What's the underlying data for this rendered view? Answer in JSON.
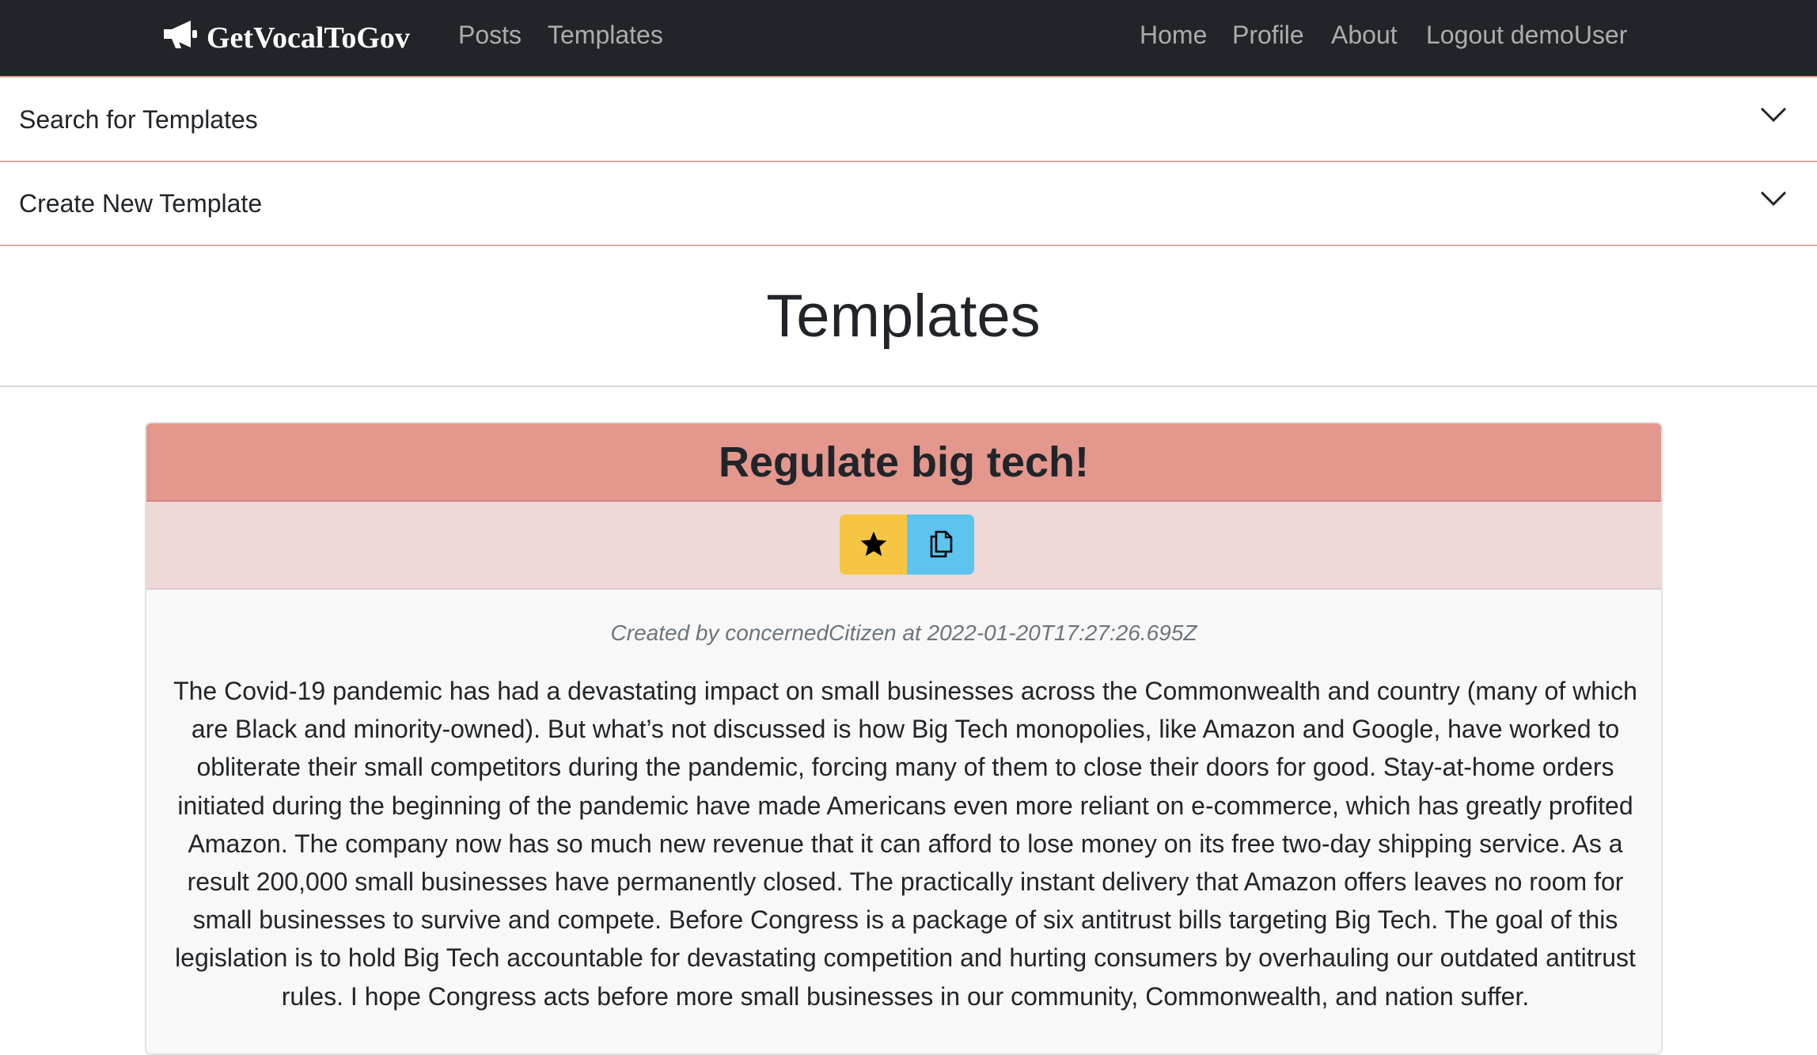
{
  "nav": {
    "brand": "GetVocalToGov",
    "posts": "Posts",
    "templates": "Templates",
    "home": "Home",
    "profile": "Profile",
    "about": "About",
    "logout": "Logout demoUser"
  },
  "accordion": {
    "search_label": "Search for Templates",
    "create_label": "Create New Template"
  },
  "page": {
    "title": "Templates"
  },
  "template_card": {
    "title": "Regulate big tech!",
    "meta": "Created by concernedCitizen at 2022-01-20T17:27:26.695Z",
    "body": "The Covid-19 pandemic has had a devastating impact on small businesses across the Commonwealth and country (many of which are Black and minority-owned). But what’s not discussed is how Big Tech monopolies, like Amazon and Google, have worked to obliterate their small competitors during the pandemic, forcing many of them to close their doors for good. Stay-at-home orders initiated during the beginning of the pandemic have made Americans even more reliant on e-commerce, which has greatly profited Amazon. The company now has so much new revenue that it can afford to lose money on its free two-day shipping service. As a result 200,000 small businesses have permanently closed. The practically instant delivery that Amazon offers leaves no room for small businesses to survive and compete. Before Congress is a package of six antitrust bills targeting Big Tech. The goal of this legislation is to hold Big Tech accountable for devastating competition and hurting consumers by overhauling our outdated antitrust rules. I hope Congress acts before more small businesses in our community, Commonwealth, and nation suffer."
  },
  "icons": {
    "brand": "megaphone-icon",
    "favorite": "star-icon",
    "copy": "copy-icon",
    "expand": "chevron-down-icon"
  },
  "colors": {
    "navbar": "#212529",
    "card_header": "#e3978d",
    "card_actions": "#eed8d8",
    "favorite_button": "#f7c544",
    "copy_button": "#5cc4ee"
  }
}
